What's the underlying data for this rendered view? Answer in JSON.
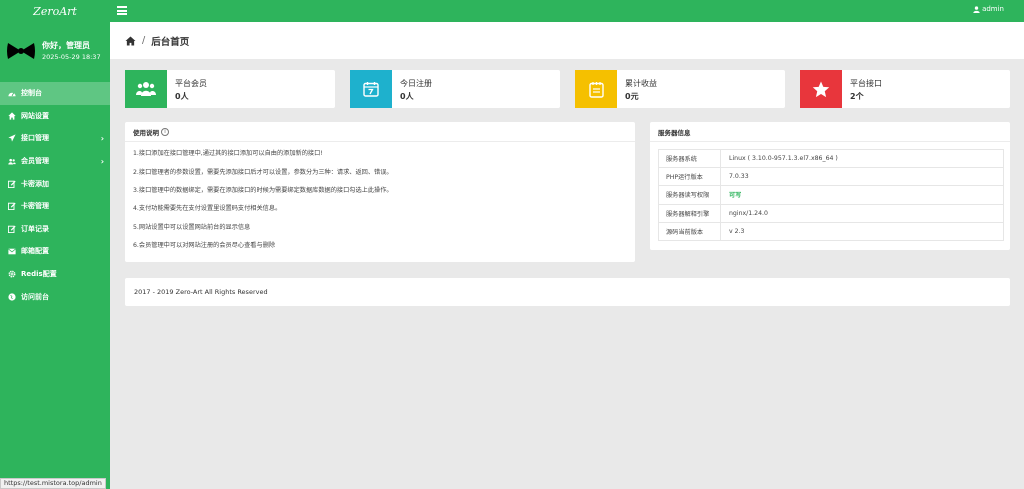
{
  "brand": {
    "logo_text": "ZeroArt"
  },
  "header": {
    "user_label": "admin"
  },
  "profile": {
    "greeting": "你好，管理员",
    "datetime": "2025-05-29 18:37"
  },
  "sidebar": {
    "items": [
      {
        "label": "控制台",
        "icon": "dashboard-icon",
        "active": true
      },
      {
        "label": "网站设置",
        "icon": "home-icon"
      },
      {
        "label": "接口管理",
        "icon": "send-icon",
        "chevron": true
      },
      {
        "label": "会员管理",
        "icon": "users-icon",
        "chevron": true
      },
      {
        "label": "卡密添加",
        "icon": "edit-icon"
      },
      {
        "label": "卡密管理",
        "icon": "edit-icon"
      },
      {
        "label": "订单记录",
        "icon": "edit-icon"
      },
      {
        "label": "邮箱配置",
        "icon": "mail-icon"
      },
      {
        "label": "Redis配置",
        "icon": "settings-icon"
      },
      {
        "label": "访问前台",
        "icon": "globe-icon"
      }
    ]
  },
  "status_url": "https://test.mistora.top/admin",
  "breadcrumb": {
    "title": "后台首页"
  },
  "stats": [
    {
      "label": "平台会员",
      "value": "0人",
      "color": "#2eb45c",
      "icon": "users-icon"
    },
    {
      "label": "今日注册",
      "value": "0人",
      "color": "#1eb1cd",
      "icon": "calendar-icon"
    },
    {
      "label": "累计收益",
      "value": "0元",
      "color": "#f5c000",
      "icon": "notepad-icon"
    },
    {
      "label": "平台接口",
      "value": "2个",
      "color": "#e8363c",
      "icon": "star-icon"
    }
  ],
  "usage": {
    "title": "使用说明",
    "help_glyph": "i",
    "lines": [
      "1.接口添加在接口管理中,通过其的接口添加可以自由的添加新的接口!",
      "2.接口管理者的参数设置，需要先添加接口后才可以设置，参数分为三种：请求、返回、错误。",
      "3.接口管理中的数据绑定，需要在添加接口的时候为需要绑定数据库数据的接口勾选上此操作。",
      "4.支付功能需要先在支付设置里设置码支付相关信息。",
      "5.网站设置中可以设置网站前台的显示信息",
      "6.会员管理中可以对网站注册的会员尽心查看与删除"
    ]
  },
  "server": {
    "title": "服务器信息",
    "rows": [
      {
        "key": "服务器系统",
        "value": "Linux ( 3.10.0-957.1.3.el7.x86_64 )"
      },
      {
        "key": "PHP运行版本",
        "value": "7.0.33"
      },
      {
        "key": "服务器读写权限",
        "value": "可写",
        "ok": true
      },
      {
        "key": "服务器解释引擎",
        "value": "nginx/1.24.0"
      },
      {
        "key": "源码当前版本",
        "value": "v 2.3"
      }
    ]
  },
  "footer": {
    "copyright": "2017 - 2019 Zero-Art All Rights Reserved"
  }
}
